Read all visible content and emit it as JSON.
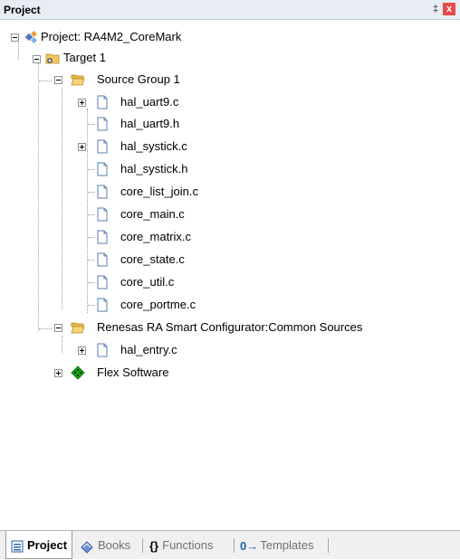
{
  "panel": {
    "title": "Project",
    "pin_glyph": "‡",
    "close_glyph": "x"
  },
  "tree": {
    "project": "Project: RA4M2_CoreMark",
    "target": "Target 1",
    "group1": "Source Group 1",
    "files1": [
      "hal_uart9.c",
      "hal_uart9.h",
      "hal_systick.c",
      "hal_systick.h",
      "core_list_join.c",
      "core_main.c",
      "core_matrix.c",
      "core_state.c",
      "core_util.c",
      "core_portme.c"
    ],
    "group2": "Renesas RA Smart Configurator:Common Sources",
    "files2": [
      "hal_entry.c"
    ],
    "flex": "Flex Software"
  },
  "tabs": [
    {
      "label": "Project",
      "icon": "project-tab-icon"
    },
    {
      "label": "Books",
      "icon": "books-tab-icon"
    },
    {
      "label": "Functions",
      "icon": "functions-tab-icon",
      "glyph": "{}"
    },
    {
      "label": "Templates",
      "icon": "templates-tab-icon",
      "glyph": "0→"
    }
  ],
  "colors": {
    "titlebar": "#e8edf3",
    "close": "#e64b4b",
    "folder": "#f3c75e",
    "flex": "#15a315"
  }
}
